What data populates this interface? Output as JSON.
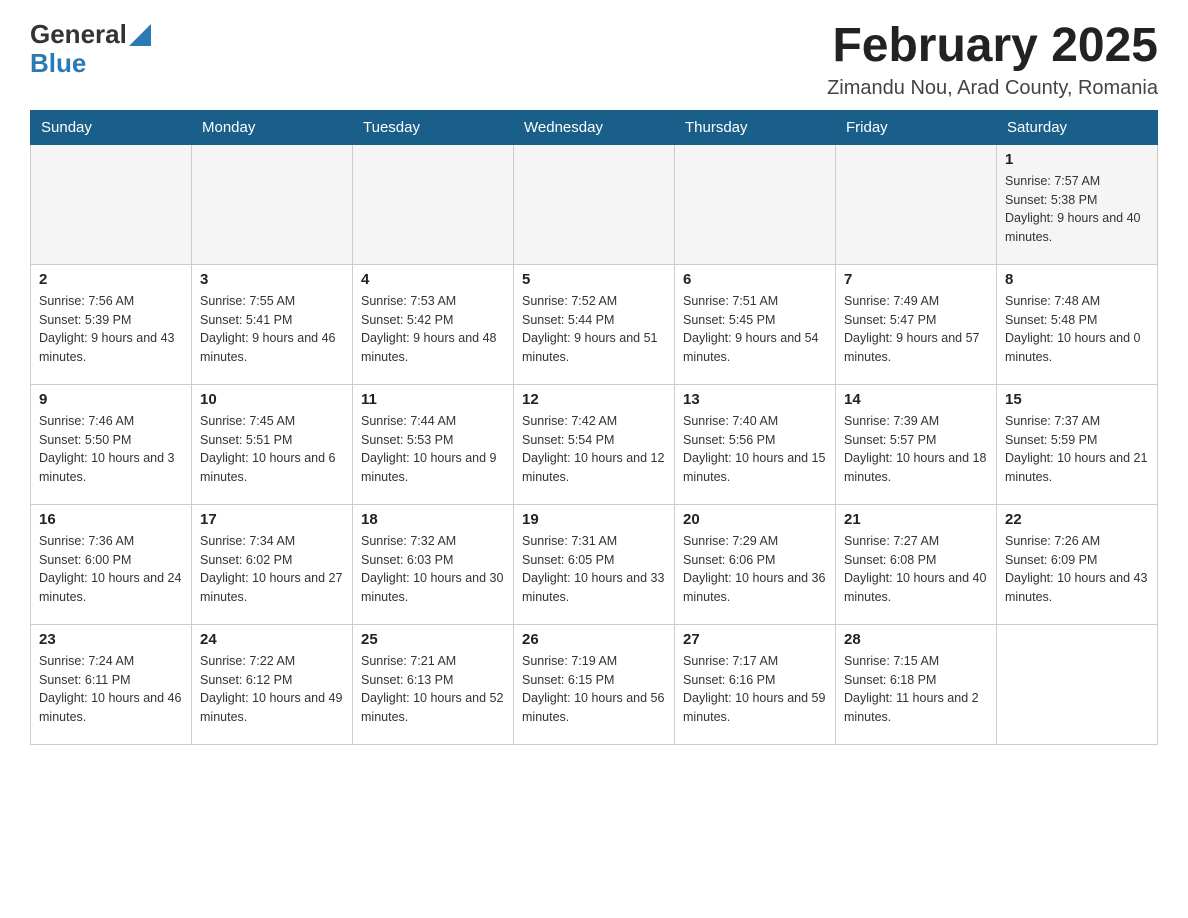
{
  "header": {
    "logo": {
      "general": "General",
      "arrow": "▲",
      "blue": "Blue"
    },
    "title": "February 2025",
    "subtitle": "Zimandu Nou, Arad County, Romania"
  },
  "weekdays": [
    "Sunday",
    "Monday",
    "Tuesday",
    "Wednesday",
    "Thursday",
    "Friday",
    "Saturday"
  ],
  "weeks": [
    [
      {
        "day": "",
        "info": ""
      },
      {
        "day": "",
        "info": ""
      },
      {
        "day": "",
        "info": ""
      },
      {
        "day": "",
        "info": ""
      },
      {
        "day": "",
        "info": ""
      },
      {
        "day": "",
        "info": ""
      },
      {
        "day": "1",
        "info": "Sunrise: 7:57 AM\nSunset: 5:38 PM\nDaylight: 9 hours and 40 minutes."
      }
    ],
    [
      {
        "day": "2",
        "info": "Sunrise: 7:56 AM\nSunset: 5:39 PM\nDaylight: 9 hours and 43 minutes."
      },
      {
        "day": "3",
        "info": "Sunrise: 7:55 AM\nSunset: 5:41 PM\nDaylight: 9 hours and 46 minutes."
      },
      {
        "day": "4",
        "info": "Sunrise: 7:53 AM\nSunset: 5:42 PM\nDaylight: 9 hours and 48 minutes."
      },
      {
        "day": "5",
        "info": "Sunrise: 7:52 AM\nSunset: 5:44 PM\nDaylight: 9 hours and 51 minutes."
      },
      {
        "day": "6",
        "info": "Sunrise: 7:51 AM\nSunset: 5:45 PM\nDaylight: 9 hours and 54 minutes."
      },
      {
        "day": "7",
        "info": "Sunrise: 7:49 AM\nSunset: 5:47 PM\nDaylight: 9 hours and 57 minutes."
      },
      {
        "day": "8",
        "info": "Sunrise: 7:48 AM\nSunset: 5:48 PM\nDaylight: 10 hours and 0 minutes."
      }
    ],
    [
      {
        "day": "9",
        "info": "Sunrise: 7:46 AM\nSunset: 5:50 PM\nDaylight: 10 hours and 3 minutes."
      },
      {
        "day": "10",
        "info": "Sunrise: 7:45 AM\nSunset: 5:51 PM\nDaylight: 10 hours and 6 minutes."
      },
      {
        "day": "11",
        "info": "Sunrise: 7:44 AM\nSunset: 5:53 PM\nDaylight: 10 hours and 9 minutes."
      },
      {
        "day": "12",
        "info": "Sunrise: 7:42 AM\nSunset: 5:54 PM\nDaylight: 10 hours and 12 minutes."
      },
      {
        "day": "13",
        "info": "Sunrise: 7:40 AM\nSunset: 5:56 PM\nDaylight: 10 hours and 15 minutes."
      },
      {
        "day": "14",
        "info": "Sunrise: 7:39 AM\nSunset: 5:57 PM\nDaylight: 10 hours and 18 minutes."
      },
      {
        "day": "15",
        "info": "Sunrise: 7:37 AM\nSunset: 5:59 PM\nDaylight: 10 hours and 21 minutes."
      }
    ],
    [
      {
        "day": "16",
        "info": "Sunrise: 7:36 AM\nSunset: 6:00 PM\nDaylight: 10 hours and 24 minutes."
      },
      {
        "day": "17",
        "info": "Sunrise: 7:34 AM\nSunset: 6:02 PM\nDaylight: 10 hours and 27 minutes."
      },
      {
        "day": "18",
        "info": "Sunrise: 7:32 AM\nSunset: 6:03 PM\nDaylight: 10 hours and 30 minutes."
      },
      {
        "day": "19",
        "info": "Sunrise: 7:31 AM\nSunset: 6:05 PM\nDaylight: 10 hours and 33 minutes."
      },
      {
        "day": "20",
        "info": "Sunrise: 7:29 AM\nSunset: 6:06 PM\nDaylight: 10 hours and 36 minutes."
      },
      {
        "day": "21",
        "info": "Sunrise: 7:27 AM\nSunset: 6:08 PM\nDaylight: 10 hours and 40 minutes."
      },
      {
        "day": "22",
        "info": "Sunrise: 7:26 AM\nSunset: 6:09 PM\nDaylight: 10 hours and 43 minutes."
      }
    ],
    [
      {
        "day": "23",
        "info": "Sunrise: 7:24 AM\nSunset: 6:11 PM\nDaylight: 10 hours and 46 minutes."
      },
      {
        "day": "24",
        "info": "Sunrise: 7:22 AM\nSunset: 6:12 PM\nDaylight: 10 hours and 49 minutes."
      },
      {
        "day": "25",
        "info": "Sunrise: 7:21 AM\nSunset: 6:13 PM\nDaylight: 10 hours and 52 minutes."
      },
      {
        "day": "26",
        "info": "Sunrise: 7:19 AM\nSunset: 6:15 PM\nDaylight: 10 hours and 56 minutes."
      },
      {
        "day": "27",
        "info": "Sunrise: 7:17 AM\nSunset: 6:16 PM\nDaylight: 10 hours and 59 minutes."
      },
      {
        "day": "28",
        "info": "Sunrise: 7:15 AM\nSunset: 6:18 PM\nDaylight: 11 hours and 2 minutes."
      },
      {
        "day": "",
        "info": ""
      }
    ]
  ]
}
